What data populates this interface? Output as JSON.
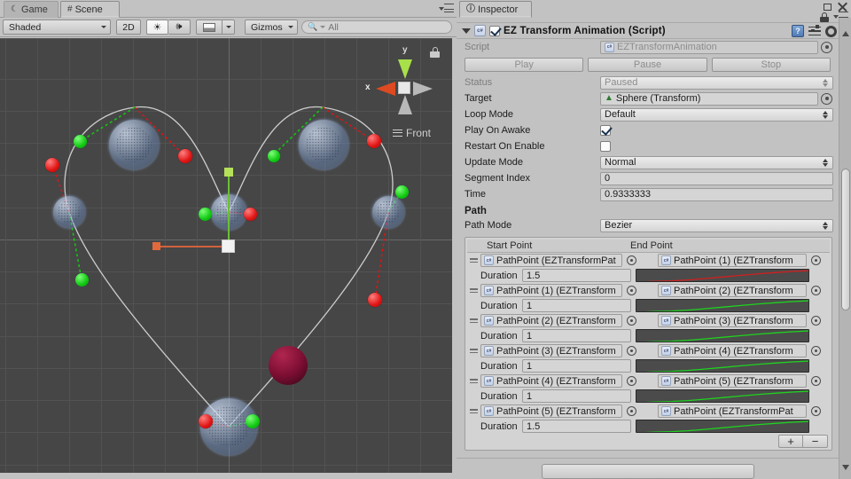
{
  "window": {
    "maximize_icon": "maximize-icon",
    "close_icon": "close-icon",
    "lock_icon": "lock-icon",
    "menu_icon": "hamburger-menu-icon"
  },
  "scene_panel": {
    "tabs": [
      {
        "label": "Game",
        "icon": "game-icon",
        "active": false
      },
      {
        "label": "Scene",
        "icon": "scene-grid-icon",
        "active": true
      }
    ],
    "toolbar": {
      "shading_mode": "Shaded",
      "view_2d": "2D",
      "lighting_icon": "sun-icon",
      "audio_icon": "speaker-icon",
      "effects_icon": "image-icon",
      "effects_dropdown_icon": "chevron-down-icon",
      "gizmos_label": "Gizmos",
      "gizmos_dropdown_icon": "chevron-down-icon",
      "search_placeholder": "All",
      "search_icon": "search-icon"
    },
    "gizmo": {
      "y_label": "y",
      "x_label": "x",
      "view_label": "Front",
      "lock_icon": "persp-lock-icon"
    }
  },
  "inspector": {
    "tab_label": "Inspector",
    "tab_icon": "info-icon",
    "component": {
      "title": "EZ Transform Animation (Script)",
      "enabled": true,
      "script_icon": "cs-script-icon",
      "help_icon": "help-icon",
      "preset_icon": "preset-icon",
      "gear_icon": "gear-icon",
      "foldout_icon": "foldout-open-icon"
    },
    "script_row": {
      "label": "Script",
      "value": "EZTransformAnimation"
    },
    "buttons": {
      "play": "Play",
      "pause": "Pause",
      "stop": "Stop"
    },
    "fields": [
      {
        "label": "Status",
        "value": "Paused",
        "type": "popup",
        "disabled": true
      },
      {
        "label": "Target",
        "value": "Sphere (Transform)",
        "type": "object",
        "icon": "transform-icon"
      },
      {
        "label": "Loop Mode",
        "value": "Default",
        "type": "popup",
        "disabled": false
      },
      {
        "label": "Play On Awake",
        "value": true,
        "type": "checkbox"
      },
      {
        "label": "Restart On Enable",
        "value": false,
        "type": "checkbox"
      },
      {
        "label": "Update Mode",
        "value": "Normal",
        "type": "popup",
        "disabled": false
      },
      {
        "label": "Segment Index",
        "value": "0",
        "type": "text"
      },
      {
        "label": "Time",
        "value": "0.9333333",
        "type": "text"
      }
    ],
    "path_section": {
      "title": "Path",
      "path_mode_label": "Path Mode",
      "path_mode_value": "Bezier"
    },
    "list": {
      "headers": {
        "start": "Start Point",
        "end": "End Point"
      },
      "duration_label": "Duration",
      "rows": [
        {
          "start": "PathPoint (EZTransformPat",
          "end": "PathPoint (1) (EZTransform",
          "duration": "1.5",
          "curve_color": "#d21f1f"
        },
        {
          "start": "PathPoint (1) (EZTransform",
          "end": "PathPoint (2) (EZTransform",
          "duration": "1",
          "curve_color": "#1fd21f"
        },
        {
          "start": "PathPoint (2) (EZTransform",
          "end": "PathPoint (3) (EZTransform",
          "duration": "1",
          "curve_color": "#1fd21f"
        },
        {
          "start": "PathPoint (3) (EZTransform",
          "end": "PathPoint (4) (EZTransform",
          "duration": "1",
          "curve_color": "#1fd21f"
        },
        {
          "start": "PathPoint (4) (EZTransform",
          "end": "PathPoint (5) (EZTransform",
          "duration": "1",
          "curve_color": "#1fd21f"
        },
        {
          "start": "PathPoint (5) (EZTransform",
          "end": "PathPoint (EZTransformPat",
          "duration": "1.5",
          "curve_color": "#1fd21f"
        }
      ],
      "add_label": "+",
      "remove_label": "−"
    }
  },
  "colors": {
    "viewport_bg": "#464646",
    "grid": "#525252",
    "handle_green": "#12c912",
    "handle_red": "#e01414",
    "gizmo_x": "#dd4a22",
    "gizmo_y": "#a8e04a",
    "object_sphere": "#7d0e33",
    "path_line": "#cdcdcd"
  }
}
